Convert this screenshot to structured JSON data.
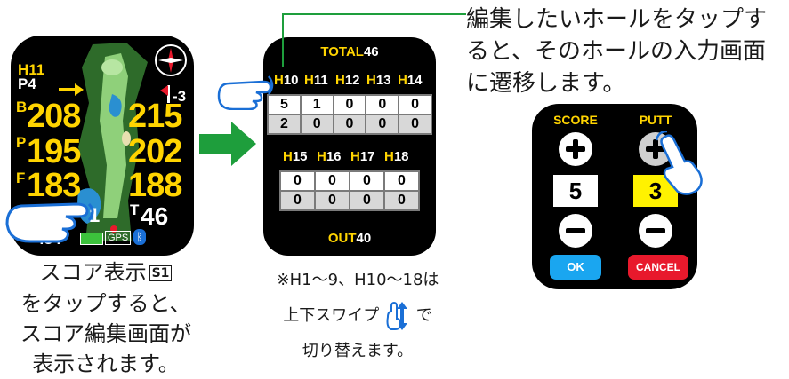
{
  "device1": {
    "hole_label": "H11",
    "par_label": "P4",
    "back_label": "B",
    "back_yard": "208",
    "back_yard_right": "215",
    "pin_label": "P",
    "pin_yard": "195",
    "pin_yard_right": "202",
    "front_label": "F",
    "front_yard": "183",
    "front_yard_right": "188",
    "score_indicator": "1",
    "total_label": "T",
    "total_value": "46",
    "flag_value": "-3",
    "clock": ":34",
    "gps_badge": "GPS"
  },
  "device2": {
    "total_label": "TOTAL",
    "total_value": "46",
    "holes_back_row1": [
      "10",
      "11",
      "12",
      "13",
      "14"
    ],
    "scores_row1": [
      "5",
      "1",
      "0",
      "0",
      "0"
    ],
    "putts_row1": [
      "2",
      "0",
      "0",
      "0",
      "0"
    ],
    "holes_back_row2": [
      "15",
      "16",
      "17",
      "18"
    ],
    "scores_row2": [
      "0",
      "0",
      "0",
      "0"
    ],
    "putts_row2": [
      "0",
      "0",
      "0",
      "0"
    ],
    "hole_prefix": "H",
    "out_label": "OUT",
    "out_value": "40"
  },
  "device3": {
    "score_label": "SCORE",
    "putt_label": "PUTT",
    "score_value": "5",
    "putt_value": "3",
    "ok_label": "OK",
    "cancel_label": "CANCEL"
  },
  "text": {
    "callout_line1": "編集したいホールをタップす",
    "callout_line2": "ると、そのホールの入力画面",
    "callout_line3": "に遷移します。",
    "left_line1": "スコア表示",
    "left_icon": "S1",
    "left_line2": "をタップすると、",
    "left_line3": "スコア編集画面が",
    "left_line4": "表示されます。",
    "note_line1": "※H1～9、H10～18は",
    "note_line2a": "上下スワイプ",
    "note_line2b": "で",
    "note_line3": "切り替えます。"
  },
  "colors": {
    "accent_yellow": "#ffd400",
    "arrow_green": "#1e9e3c",
    "ok_blue": "#1aa6f0",
    "cancel_red": "#e8192c",
    "course_green": "#3f9a3a",
    "water_blue": "#2a8fd1"
  }
}
